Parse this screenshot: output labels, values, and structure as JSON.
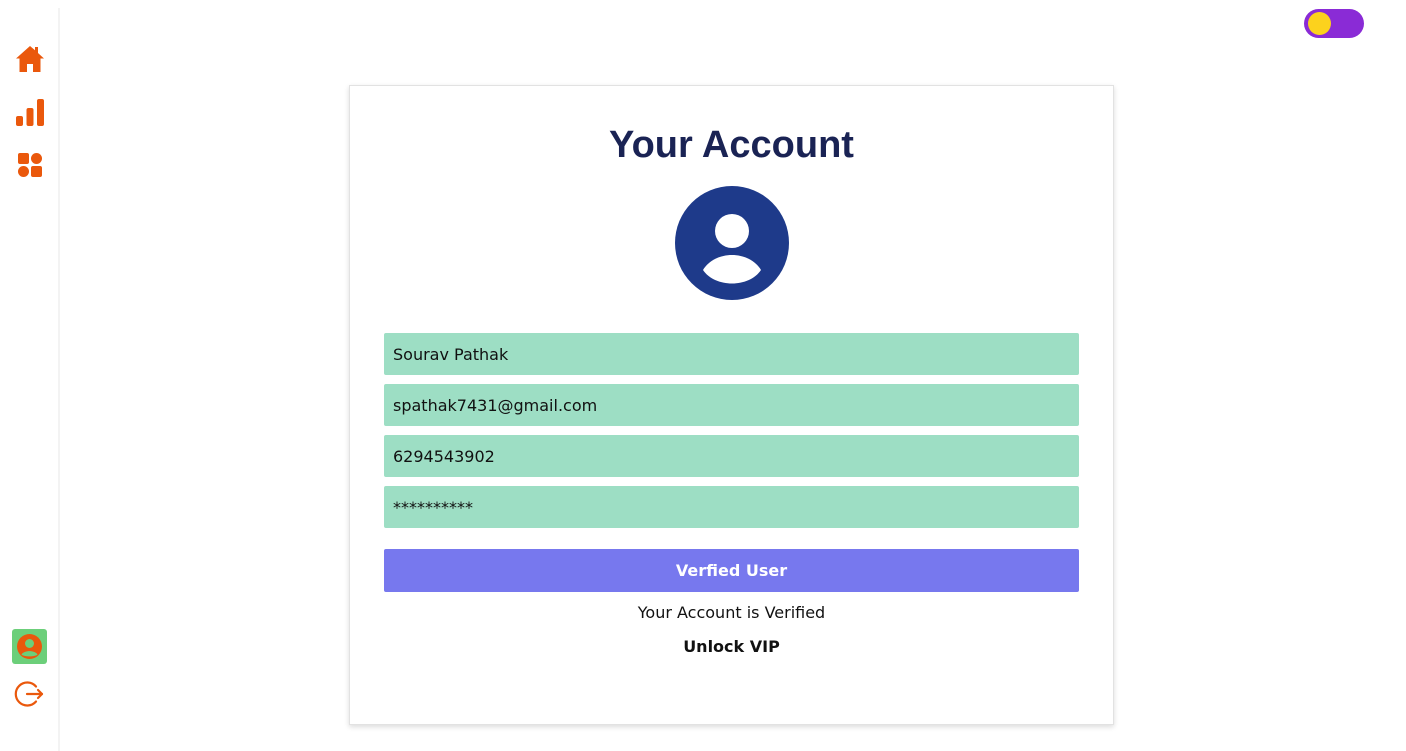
{
  "colors": {
    "accent": "#ea580c",
    "title": "#1a2354",
    "field_bg": "#9ddec4",
    "button_bg": "#7778ee",
    "avatar_bg": "#1e3a8a",
    "toggle_track": "#8a2bd6",
    "toggle_knob": "#fcd21d",
    "profile_nav_bg": "#6ccf7a"
  },
  "sidebar": {
    "items": [
      {
        "icon": "home-icon"
      },
      {
        "icon": "bar-chart-icon"
      },
      {
        "icon": "apps-grid-icon"
      }
    ],
    "profile_icon": "user-circle-icon",
    "logout_icon": "logout-icon"
  },
  "header": {
    "theme_toggle_icon": "theme-toggle"
  },
  "account": {
    "title": "Your Account",
    "avatar_icon": "user-avatar-icon",
    "fields": {
      "name": "Sourav Pathak",
      "email": "spathak7431@gmail.com",
      "phone": "6294543902",
      "password": "**********"
    },
    "verify_button_label": "Verfied User",
    "status_text": "Your Account is Verified",
    "vip_link": "Unlock VIP"
  }
}
